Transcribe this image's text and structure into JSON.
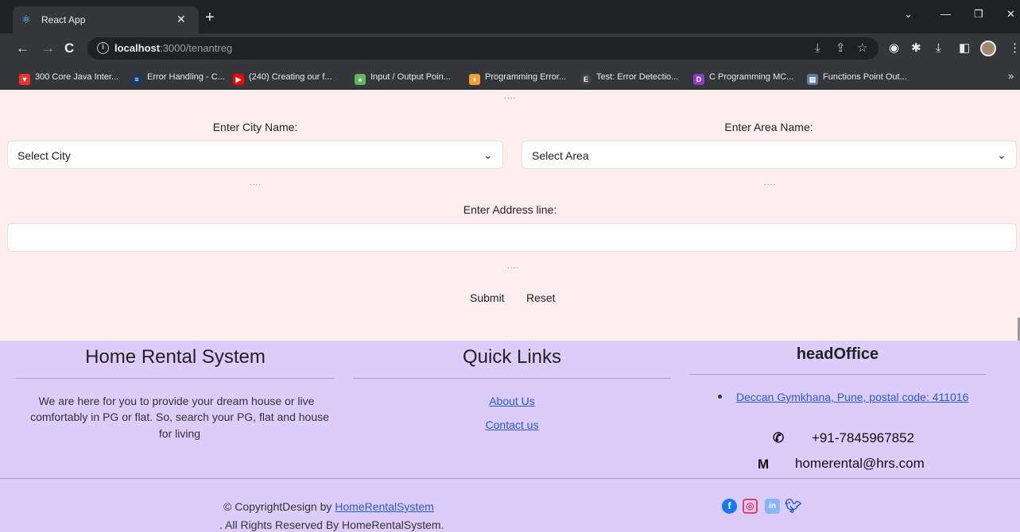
{
  "browser": {
    "tab_title": "React App",
    "url_host": "localhost",
    "url_path": ":3000/tenantreg",
    "bookmarks": [
      {
        "label": "300 Core Java Inter...",
        "color": "#e8352e"
      },
      {
        "label": "Error Handling - C...",
        "color": "#1e3a6b"
      },
      {
        "label": "(240) Creating our f...",
        "color": "#ff0000"
      },
      {
        "label": "Input / Output Poin...",
        "color": "#5cb85c"
      },
      {
        "label": "Programming Error...",
        "color": "#f0a030"
      },
      {
        "label": "Test: Error Detectio...",
        "color": "#444444"
      },
      {
        "label": "C Programming MC...",
        "color": "#8a3fc7"
      },
      {
        "label": "Functions Point Out...",
        "color": "#5c7a99"
      }
    ]
  },
  "form": {
    "separator": "....",
    "city_label": "Enter City Name:",
    "city_value": "Select City",
    "area_label": "Enter Area Name:",
    "area_value": "Select Area",
    "address_label": "Enter Address line:",
    "submit_label": "Submit",
    "reset_label": "Reset"
  },
  "footer": {
    "brand_title": "Home Rental System",
    "brand_text": [
      "We are here for you to provide your dream house or live",
      "comfortably in PG or flat. So, search your PG, flat and house",
      "for living"
    ],
    "links_title": "Quick Links",
    "links": [
      "About Us",
      "Contact us"
    ],
    "office_title": "headOffice",
    "office_address": "Deccan Gymkhana, Pune, postal code: 411016",
    "phone": "+91-7845967852",
    "email": "homerental@hrs.com",
    "copyright_prefix": "© CopyrightDesign by ",
    "copyright_link": "HomeRentalSystem",
    "rights": ". All Rights Reserved By HomeRentalSystem."
  },
  "colors": {
    "form_bg": "#fdeff0",
    "footer_bg": "#dcccfa",
    "link": "#2a5bd7"
  }
}
